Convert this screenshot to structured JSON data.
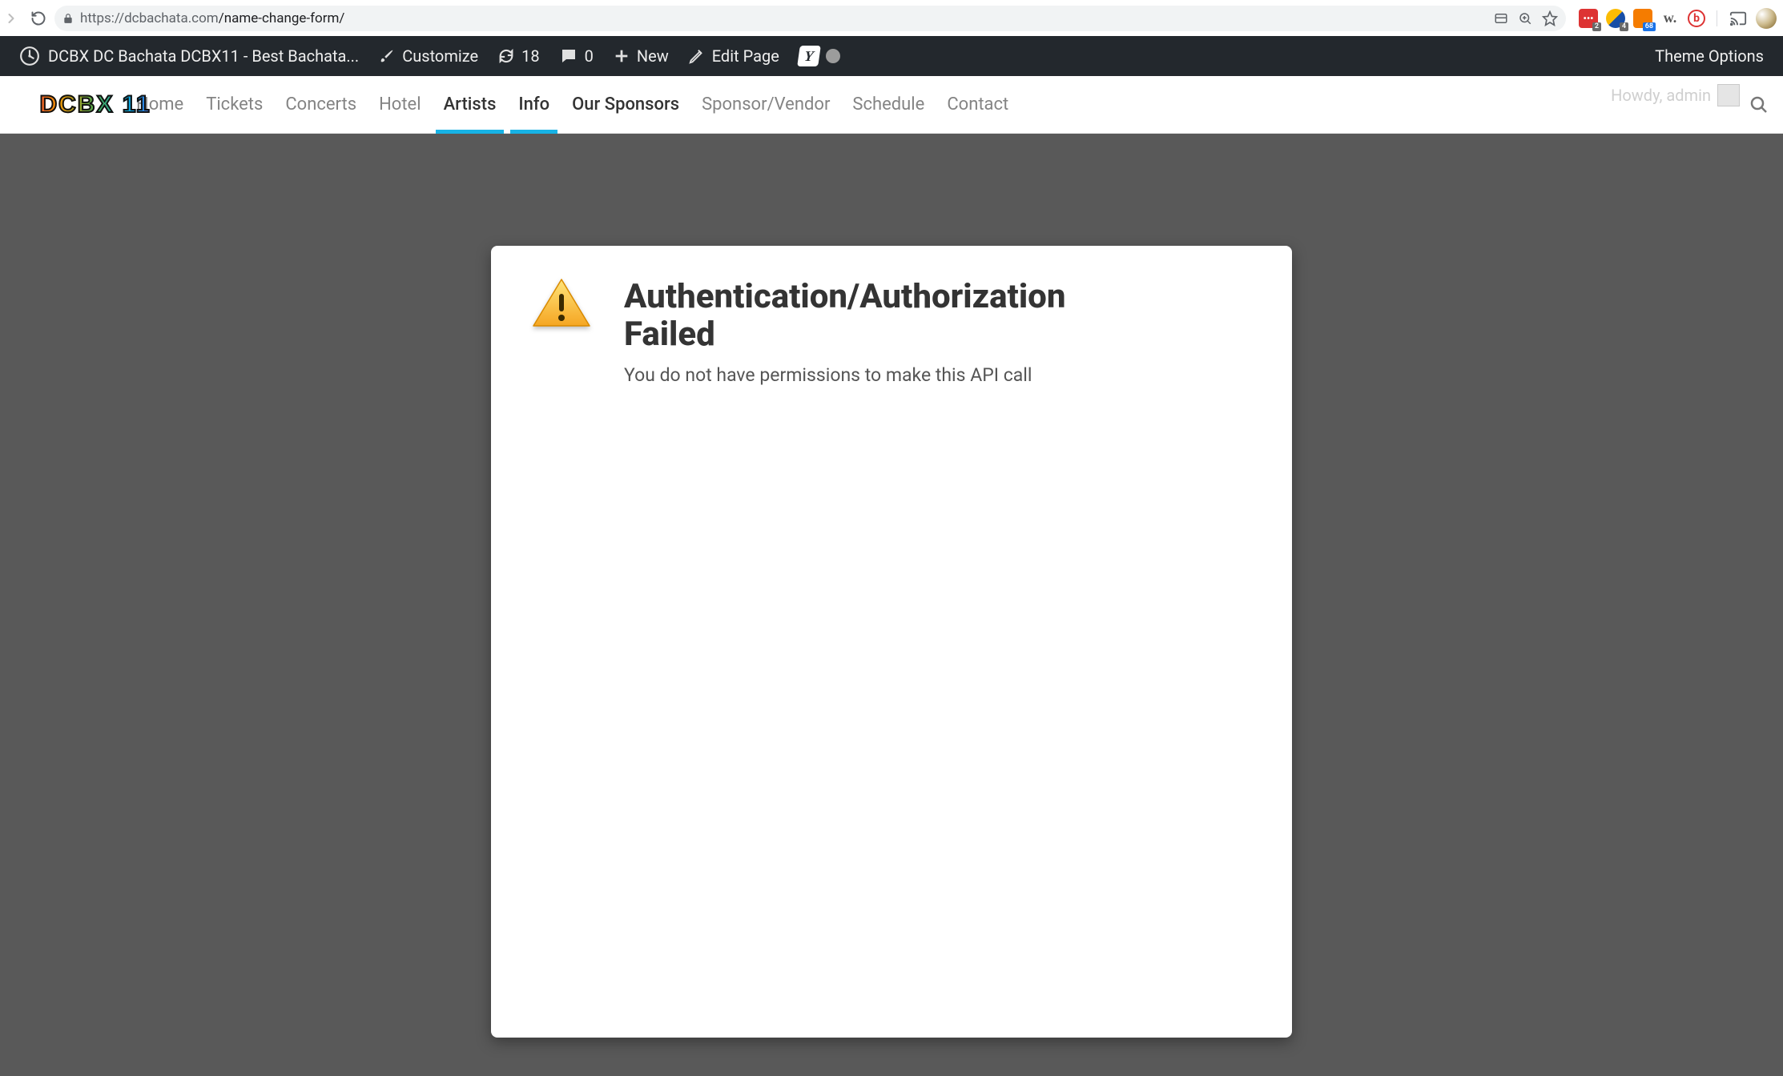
{
  "browser": {
    "url_scheme_host": "https://dcbachata.com",
    "url_path": "/name-change-form/",
    "ext_badges": {
      "e1": "2",
      "e2": "4",
      "e3": "68"
    },
    "ext4_label": "w.",
    "ext5_label": "b"
  },
  "wp_admin": {
    "site_title": "DCBX DC Bachata DCBX11 - Best Bachata...",
    "customize": "Customize",
    "updates_count": "18",
    "comments_count": "0",
    "new_label": "New",
    "edit_label": "Edit Page",
    "theme_options": "Theme Options",
    "yoast": "Y"
  },
  "site_nav": {
    "logo_text": "DCBX 11",
    "items": [
      {
        "label": "Home"
      },
      {
        "label": "Tickets"
      },
      {
        "label": "Concerts"
      },
      {
        "label": "Hotel"
      },
      {
        "label": "Artists"
      },
      {
        "label": "Info",
        "active": true
      },
      {
        "label": "Our Sponsors",
        "active": true
      },
      {
        "label": "Sponsor/Vendor"
      },
      {
        "label": "Schedule"
      },
      {
        "label": "Contact"
      }
    ],
    "howdy": "Howdy, admin"
  },
  "error": {
    "title_line1": "Authentication/Authorization",
    "title_line2": "Failed",
    "message": "You do not have permissions to make this API call"
  }
}
